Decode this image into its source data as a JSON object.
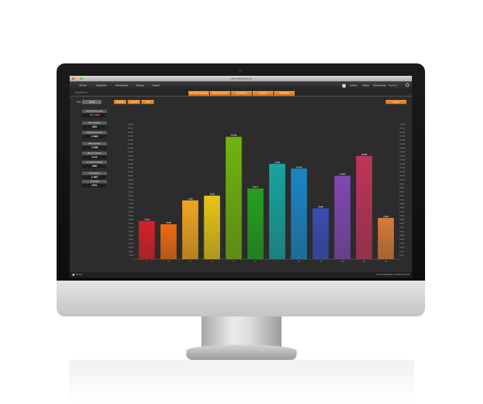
{
  "window": {
    "title": "Cabis CRM Dashboard"
  },
  "navbar": {
    "items": [
      "Klienci",
      "Zapytania",
      "Zamówienia",
      "Faktury",
      "Raport"
    ],
    "right": [
      "Lewos",
      "Ustaw",
      "Dokumenty",
      "Raporty"
    ]
  },
  "breadcrumb": "Moje Raporty",
  "tabs": [
    "Sprzedaż okresowa",
    "Okresy Klientów",
    "Rozliczenia",
    "Zestawy",
    "Wskaźniki"
  ],
  "toolbar": {
    "year_label": "Rok",
    "year_value": "2016",
    "buttons": [
      "Miesiąc",
      "Kwartał",
      "Rok"
    ],
    "print_label": "Drukuj"
  },
  "stats": [
    {
      "label": "Przychody PLN netto",
      "value": "561 998",
      "highlight": true
    },
    {
      "label": "Ilość zamówień",
      "value": "634",
      "highlight": false
    },
    {
      "label": "Przychód na zamów.",
      "value": "1 360",
      "highlight": false
    },
    {
      "label": "Ilość zamówień",
      "value": "1 349",
      "highlight": false
    },
    {
      "label": "Marża na zamów.",
      "value": "2.13",
      "highlight": false
    },
    {
      "label": "Przychód na klienta",
      "value": "839",
      "highlight": false
    },
    {
      "label": "Ilość klientów",
      "value": "1 357",
      "highlight": false
    },
    {
      "label": "% wzrostu",
      "value": "47%",
      "highlight": false
    }
  ],
  "status_bar": {
    "left": "Bieżący",
    "right": "Ostatnia aktualizacja: 1.06.2016 17:00:45"
  },
  "chart_data": {
    "type": "bar",
    "categories": [
      "1",
      "2",
      "3",
      "4",
      "5",
      "6",
      "7",
      "8",
      "9",
      "10",
      "11",
      "12"
    ],
    "values": [
      48,
      44,
      74,
      80,
      154,
      89,
      120,
      114,
      64,
      105,
      130,
      52
    ],
    "value_labels": [
      "47,999",
      "43,888",
      "73,888",
      "79,888",
      "153,999",
      "88,874",
      "119,888",
      "113,888",
      "63,888",
      "104,888",
      "129,888",
      "51,888"
    ],
    "ylim": [
      0,
      170
    ],
    "colors": [
      "#d6202c",
      "#ee6b10",
      "#f0a520",
      "#e8c618",
      "#70b40e",
      "#24a020",
      "#17a4a0",
      "#1a86c4",
      "#3a4cb4",
      "#8048b0",
      "#be3458",
      "#d87a38"
    ],
    "grid": false,
    "legend": "none"
  },
  "colors": {
    "accent": "#e8821e",
    "screen_bg": "#2c2c2c"
  },
  "icons": [
    "power-icon",
    "user-icon"
  ]
}
